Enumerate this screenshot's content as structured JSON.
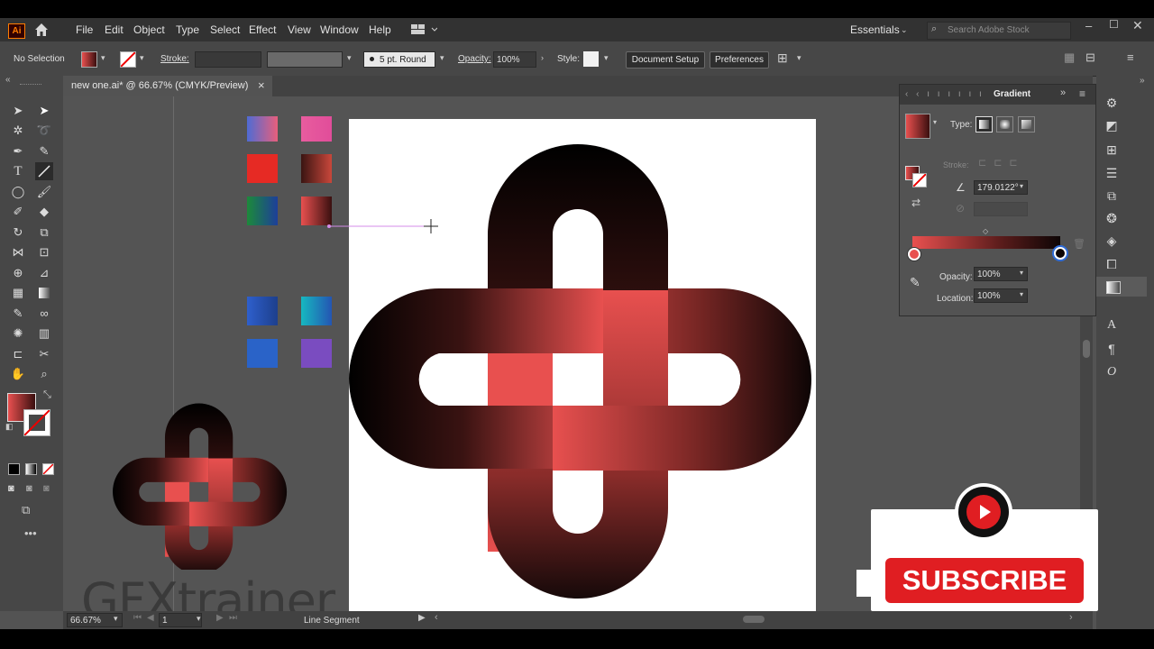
{
  "colors": {
    "accent_red": "#e8504f",
    "dark": "#160909",
    "youtube_red": "#e01e22"
  },
  "menubar": {
    "app_badge": "Ai",
    "items": [
      "File",
      "Edit",
      "Object",
      "Type",
      "Select",
      "Effect",
      "View",
      "Window",
      "Help"
    ],
    "workspace": "Essentials",
    "search_placeholder": "Search Adobe Stock"
  },
  "control": {
    "selection": "No Selection",
    "stroke_label": "Stroke:",
    "brush": "5 pt. Round",
    "opacity_label": "Opacity:",
    "opacity_value": "100%",
    "style_label": "Style:",
    "doc_setup": "Document Setup",
    "preferences": "Preferences"
  },
  "document": {
    "tab_title": "new one.ai* @ 66.67% (CMYK/Preview)",
    "close": "×"
  },
  "gradient_panel": {
    "title": "Gradient",
    "type_label": "Type:",
    "stroke_label": "Stroke:",
    "angle": "179.0122°",
    "opacity_label": "Opacity:",
    "opacity_value": "100%",
    "location_label": "Location:",
    "location_value": "100%"
  },
  "status": {
    "zoom": "66.67%",
    "artboard": "1",
    "tool": "Line Segment"
  },
  "watermark": "GFXtrainer",
  "subscribe": "SUBSCRIBE"
}
